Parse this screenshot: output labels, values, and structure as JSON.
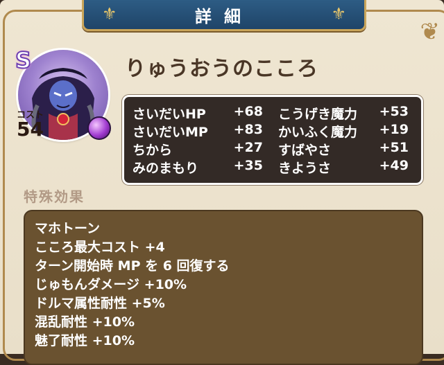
{
  "header": {
    "title": "詳細"
  },
  "monster": {
    "rank": "S",
    "name": "りゅうおうのこころ",
    "cost_label": "コスト",
    "cost_value": "54"
  },
  "stats": [
    {
      "label": "さいだいHP",
      "value": "+68"
    },
    {
      "label": "こうげき魔力",
      "value": "+53"
    },
    {
      "label": "さいだいMP",
      "value": "+83"
    },
    {
      "label": "かいふく魔力",
      "value": "+19"
    },
    {
      "label": "ちから",
      "value": "+27"
    },
    {
      "label": "すばやさ",
      "value": "+51"
    },
    {
      "label": "みのまもり",
      "value": "+35"
    },
    {
      "label": "きようさ",
      "value": "+49"
    }
  ],
  "special": {
    "label": "特殊効果",
    "effects": [
      "マホトーン",
      "こころ最大コスト +4",
      "ターン開始時 MP を 6 回復する",
      "じゅもんダメージ +10%",
      "ドルマ属性耐性 +5%",
      "混乱耐性 +10%",
      "魅了耐性 +10%"
    ]
  },
  "colors": {
    "title_plate": "#1f4468",
    "stats_box": "#332a26",
    "effects_box": "#6a5230",
    "orb": "#a03bd0"
  },
  "icons": [
    "fleur-de-lis-icon",
    "ornament-corner-icon",
    "purple-orb-icon",
    "rank-s-badge"
  ]
}
